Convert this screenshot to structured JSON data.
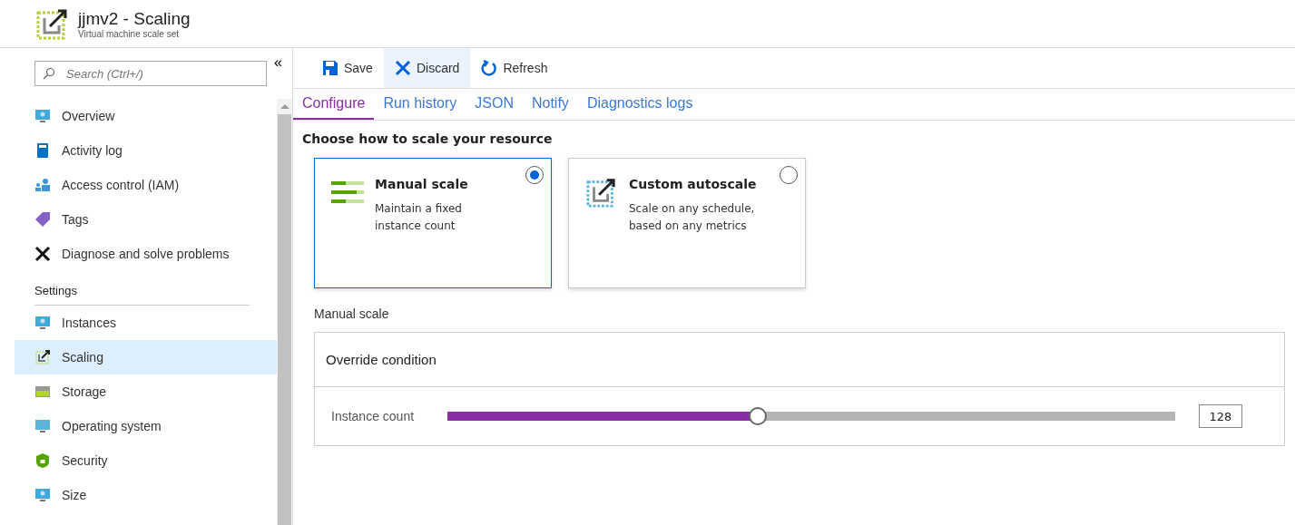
{
  "header": {
    "title": "jjmv2 - Scaling",
    "subtitle": "Virtual machine scale set"
  },
  "sidebar": {
    "search": {
      "placeholder": "Search (Ctrl+/)"
    },
    "collapse": "«",
    "items": [
      {
        "kind": "item",
        "label": "Overview",
        "selected": false
      },
      {
        "kind": "item",
        "label": "Activity log",
        "selected": false
      },
      {
        "kind": "item",
        "label": "Access control (IAM)",
        "selected": false
      },
      {
        "kind": "item",
        "label": "Tags",
        "selected": false
      },
      {
        "kind": "item",
        "label": "Diagnose and solve problems",
        "selected": false
      },
      {
        "kind": "heading",
        "label": "Settings"
      },
      {
        "kind": "item",
        "label": "Instances",
        "selected": false
      },
      {
        "kind": "item",
        "label": "Scaling",
        "selected": true
      },
      {
        "kind": "item",
        "label": "Storage",
        "selected": false
      },
      {
        "kind": "item",
        "label": "Operating system",
        "selected": false
      },
      {
        "kind": "item",
        "label": "Security",
        "selected": false
      },
      {
        "kind": "item",
        "label": "Size",
        "selected": false
      }
    ]
  },
  "toolbar": [
    {
      "label": "Save",
      "selected": false
    },
    {
      "label": "Discard",
      "selected": true
    },
    {
      "label": "Refresh",
      "selected": false
    }
  ],
  "tabs": [
    {
      "label": "Configure",
      "selected": true
    },
    {
      "label": "Run history",
      "selected": false
    },
    {
      "label": "JSON",
      "selected": false
    },
    {
      "label": "Notify",
      "selected": false
    },
    {
      "label": "Diagnostics logs",
      "selected": false
    }
  ],
  "heading": "Choose how to scale your resource",
  "options": [
    {
      "title": "Manual scale",
      "description": "Maintain a fixed instance count",
      "selected": true
    },
    {
      "title": "Custom autoscale",
      "description": "Scale on any schedule, based on any metrics",
      "selected": false
    }
  ],
  "section_label": "Manual scale",
  "panel": {
    "title": "Override condition",
    "slider_label": "Instance count",
    "level": 0.425,
    "value": "128"
  }
}
